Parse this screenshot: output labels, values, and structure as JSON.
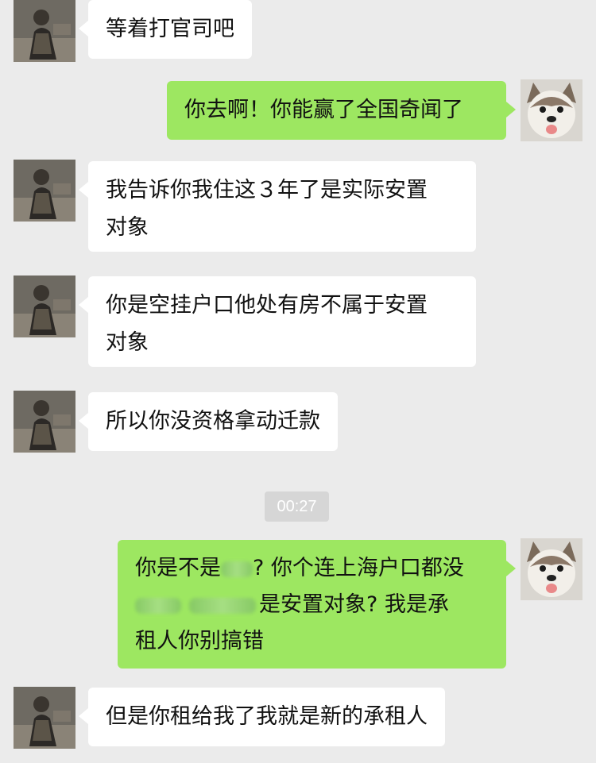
{
  "chat": {
    "messages": [
      {
        "sender": "other",
        "text": "等着打官司吧"
      },
      {
        "sender": "self",
        "text": "你去啊！你能赢了全国奇闻了"
      },
      {
        "sender": "other",
        "lines": [
          "我告诉你我住这３年了是实际安置",
          "对象"
        ]
      },
      {
        "sender": "other",
        "lines": [
          "你是空挂户口他处有房不属于安置",
          "对象"
        ]
      },
      {
        "sender": "other",
        "text": "所以你没资格拿动迁款"
      },
      {
        "sender": "self",
        "line1_pre": "你是不是",
        "line1_post": "? 你个连上海户口都没",
        "line2_post": "是安置对象?   我是承",
        "line3": "租人你别搞错"
      },
      {
        "sender": "other",
        "text": "但是你租给我了我就是新的承租人"
      }
    ],
    "timestamp": "00:27"
  },
  "avatars": {
    "other": "person-avatar-icon",
    "self": "dog-avatar-icon"
  },
  "colors": {
    "background": "#ebebeb",
    "incoming_bubble": "#ffffff",
    "outgoing_bubble": "#9de761",
    "timestamp_badge": "#d6d6d6"
  }
}
